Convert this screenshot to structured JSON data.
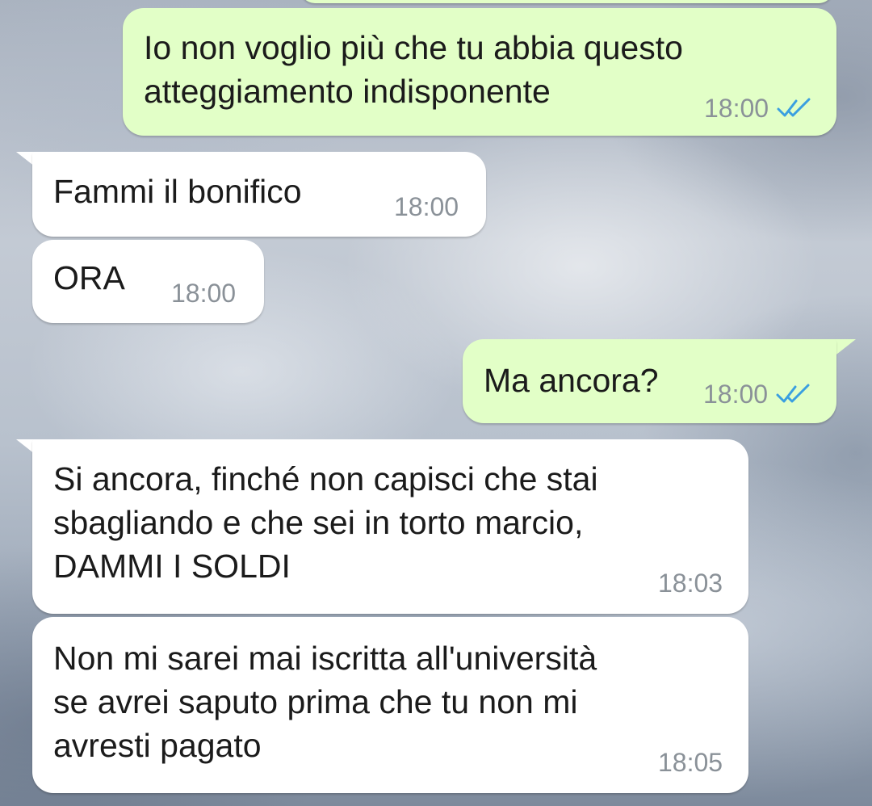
{
  "messages": [
    {
      "direction": "out",
      "text": "Io non voglio più che tu abbia questo\natteggiamento indisponente",
      "time": "18:00",
      "status": "read"
    },
    {
      "direction": "in",
      "text": "Fammi il bonifico",
      "time": "18:00"
    },
    {
      "direction": "in",
      "text": "ORA",
      "time": "18:00"
    },
    {
      "direction": "out",
      "text": "Ma ancora?",
      "time": "18:00",
      "status": "read"
    },
    {
      "direction": "in",
      "text": "Si ancora, finché non capisci che stai\nsbagliando e che sei in torto marcio,\nDAMMI I SOLDI",
      "time": "18:03"
    },
    {
      "direction": "in",
      "text": "Non mi sarei mai iscritta all'università\nse avrei saputo prima che tu non mi\navresti pagato",
      "time": "18:05"
    }
  ],
  "colors": {
    "outgoing_bubble": "#e2ffc7",
    "incoming_bubble": "#ffffff",
    "read_ticks": "#3a9fe0",
    "timestamp": "#8a9198"
  },
  "icons": {
    "read_receipt": "double-check-icon"
  }
}
